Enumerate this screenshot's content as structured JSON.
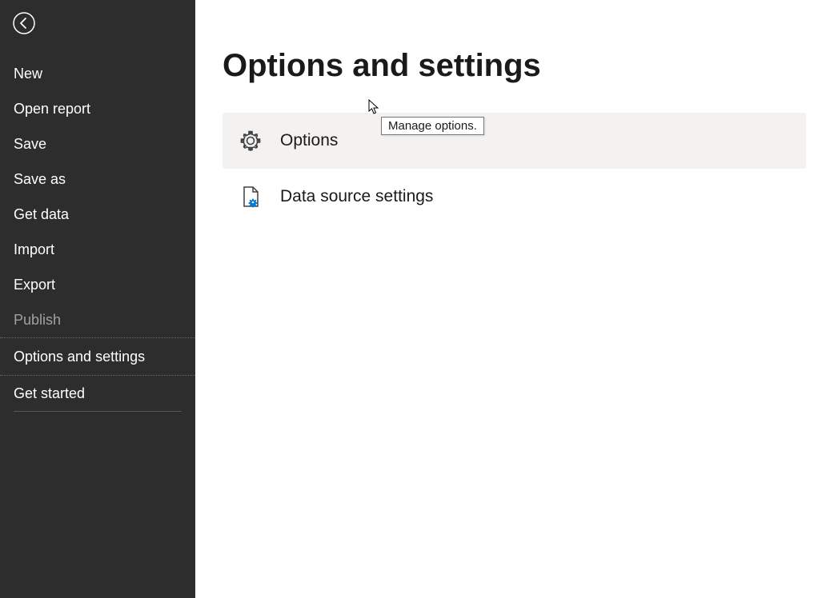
{
  "sidebar": {
    "items": [
      {
        "label": "New",
        "selected": false,
        "disabled": false
      },
      {
        "label": "Open report",
        "selected": false,
        "disabled": false
      },
      {
        "label": "Save",
        "selected": false,
        "disabled": false
      },
      {
        "label": "Save as",
        "selected": false,
        "disabled": false
      },
      {
        "label": "Get data",
        "selected": false,
        "disabled": false
      },
      {
        "label": "Import",
        "selected": false,
        "disabled": false
      },
      {
        "label": "Export",
        "selected": false,
        "disabled": false
      },
      {
        "label": "Publish",
        "selected": false,
        "disabled": true
      },
      {
        "label": "Options and settings",
        "selected": true,
        "disabled": false
      },
      {
        "label": "Get started",
        "selected": false,
        "disabled": false
      }
    ]
  },
  "main": {
    "title": "Options and settings",
    "rows": [
      {
        "label": "Options",
        "hovered": true
      },
      {
        "label": "Data source settings",
        "hovered": false
      }
    ]
  },
  "tooltip": {
    "text": "Manage options."
  }
}
